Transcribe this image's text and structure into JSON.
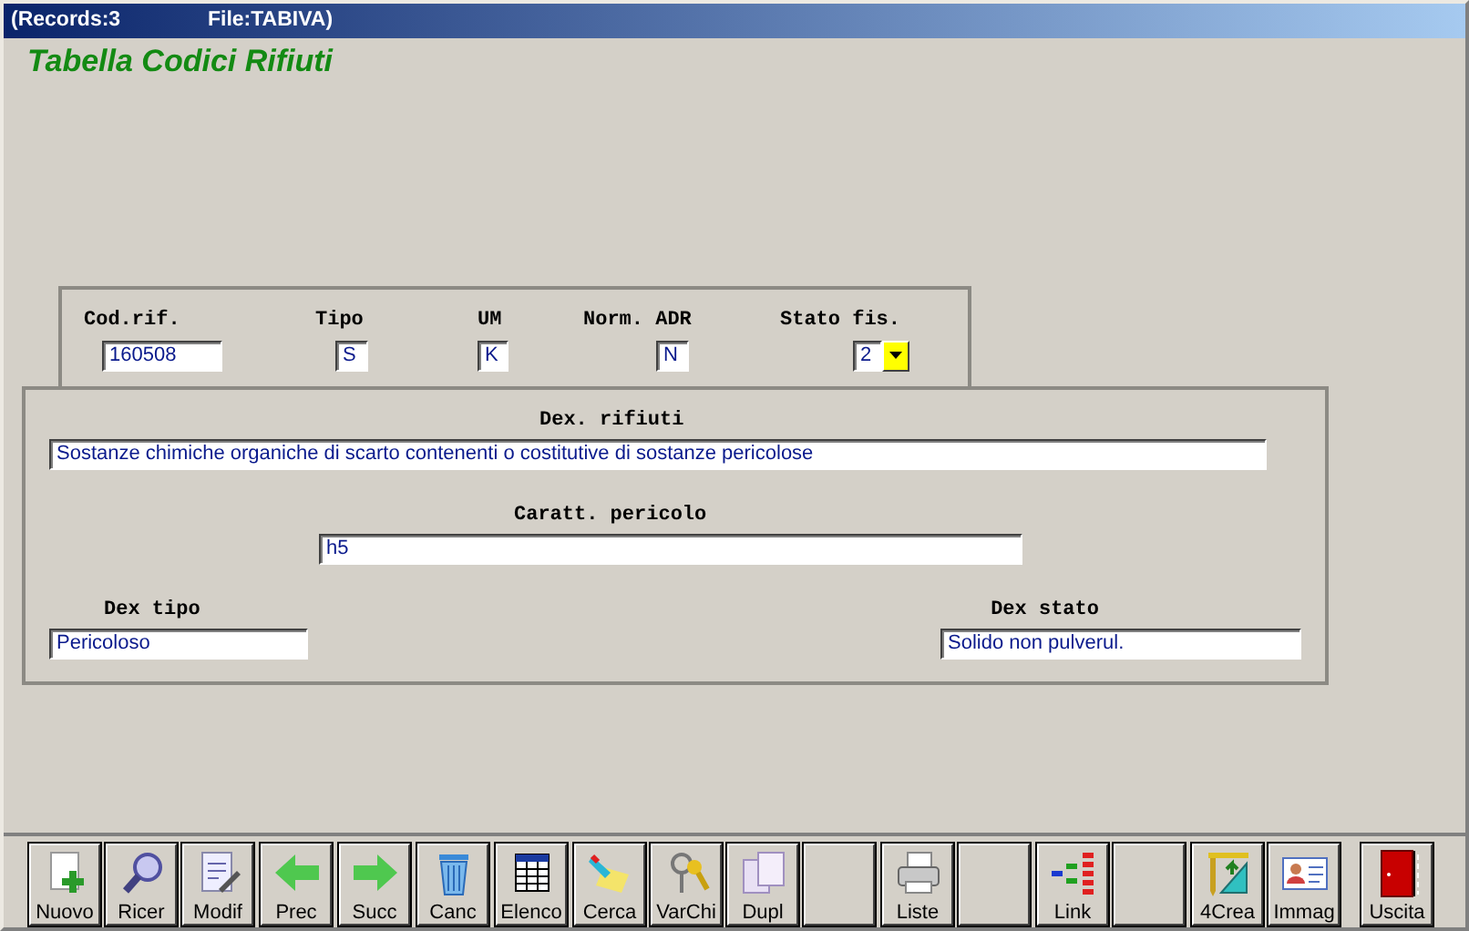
{
  "window": {
    "title_records": "(Records:3",
    "title_file": "File:TABIVA)"
  },
  "heading": "Tabella Codici Rifiuti",
  "header_fields": [
    {
      "label": "Cod.rif.",
      "value": "160508",
      "kind": "text"
    },
    {
      "label": "Tipo",
      "value": "S",
      "kind": "text"
    },
    {
      "label": "UM",
      "value": "K",
      "kind": "text"
    },
    {
      "label": "Norm. ADR",
      "value": "N",
      "kind": "text"
    },
    {
      "label": "Stato fis.",
      "value": "2",
      "kind": "dropdown"
    }
  ],
  "detail_fields": [
    {
      "label": "Dex. rifiuti",
      "value": "Sostanze chimiche organiche di scarto contenenti o costitutive di sostanze pericolose"
    },
    {
      "label": "Caratt. pericolo",
      "value": "h5"
    },
    {
      "label": "Dex tipo",
      "value": "Pericoloso"
    },
    {
      "label": "Dex stato",
      "value": "Solido non pulverul."
    }
  ],
  "toolbar": [
    {
      "kind": "new",
      "label": "Nuovo"
    },
    {
      "kind": "search",
      "label": "Ricer"
    },
    {
      "kind": "edit",
      "label": "Modif"
    },
    {
      "kind": "prev",
      "label": "Prec"
    },
    {
      "kind": "next",
      "label": "Succ"
    },
    {
      "kind": "trash",
      "label": "Canc"
    },
    {
      "kind": "table",
      "label": "Elenco"
    },
    {
      "kind": "find",
      "label": "Cerca"
    },
    {
      "kind": "keys",
      "label": "VarChi"
    },
    {
      "kind": "copy",
      "label": "Dupl"
    },
    {
      "kind": "blank"
    },
    {
      "kind": "print",
      "label": "Liste"
    },
    {
      "kind": "blank"
    },
    {
      "kind": "link",
      "label": "Link"
    },
    {
      "kind": "blank"
    },
    {
      "kind": "create",
      "label": "4Crea"
    },
    {
      "kind": "card",
      "label": "Immag"
    },
    {
      "kind": "exit",
      "label": "Uscita"
    }
  ]
}
